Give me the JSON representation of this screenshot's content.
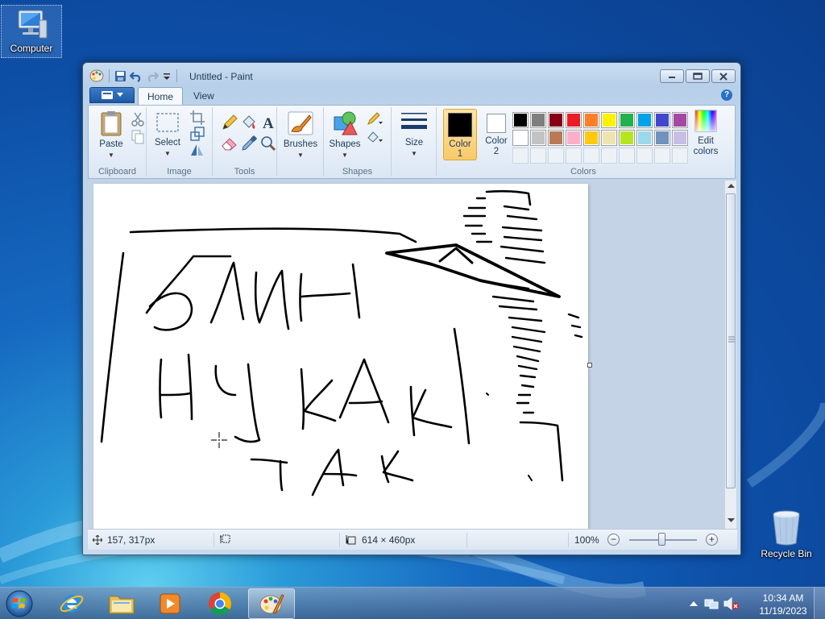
{
  "desktop": {
    "icons": [
      {
        "label": "Computer",
        "icon": "computer-icon"
      },
      {
        "label": "Recycle Bin",
        "icon": "recycle-bin-icon"
      }
    ]
  },
  "window": {
    "title": "Untitled - Paint",
    "tabs": [
      "Home",
      "View"
    ],
    "help_glyph": "?"
  },
  "ribbon": {
    "clipboard": {
      "label": "Clipboard",
      "paste": "Paste"
    },
    "image": {
      "label": "Image",
      "select": "Select"
    },
    "tools": {
      "label": "Tools"
    },
    "brushes": {
      "label": "Brushes"
    },
    "shapes": {
      "label": "Shapes",
      "shapes_btn": "Shapes"
    },
    "size": {
      "label": "Size"
    },
    "colors": {
      "label": "Colors",
      "color1": "Color 1",
      "color1_line1": "Color",
      "color1_line2": "1",
      "color2_line1": "Color",
      "color2_line2": "2",
      "edit_line1": "Edit",
      "edit_line2": "colors",
      "color1_value": "#000000",
      "color2_value": "#ffffff",
      "palette": [
        "#000000",
        "#7f7f7f",
        "#880015",
        "#ed1c24",
        "#ff7f27",
        "#fff200",
        "#22b14c",
        "#00a2e8",
        "#3f48cc",
        "#a349a4",
        "#ffffff",
        "#c3c3c3",
        "#b97a57",
        "#ffaec9",
        "#ffc90e",
        "#efe4b0",
        "#b5e61d",
        "#99d9ea",
        "#7092be",
        "#c8bfe7"
      ],
      "custom_slots": 10
    }
  },
  "canvas": {
    "drawing_text": [
      "БЛИН",
      "НУ КАК",
      "ТАК"
    ]
  },
  "status": {
    "cursor_pos": "157, 317px",
    "image_size": "614 × 460px",
    "zoom": "100%"
  },
  "taskbar": {
    "time": "10:34 AM",
    "date": "11/19/2023",
    "apps": [
      "internet-explorer",
      "file-explorer",
      "media-player",
      "chrome",
      "paint"
    ]
  }
}
